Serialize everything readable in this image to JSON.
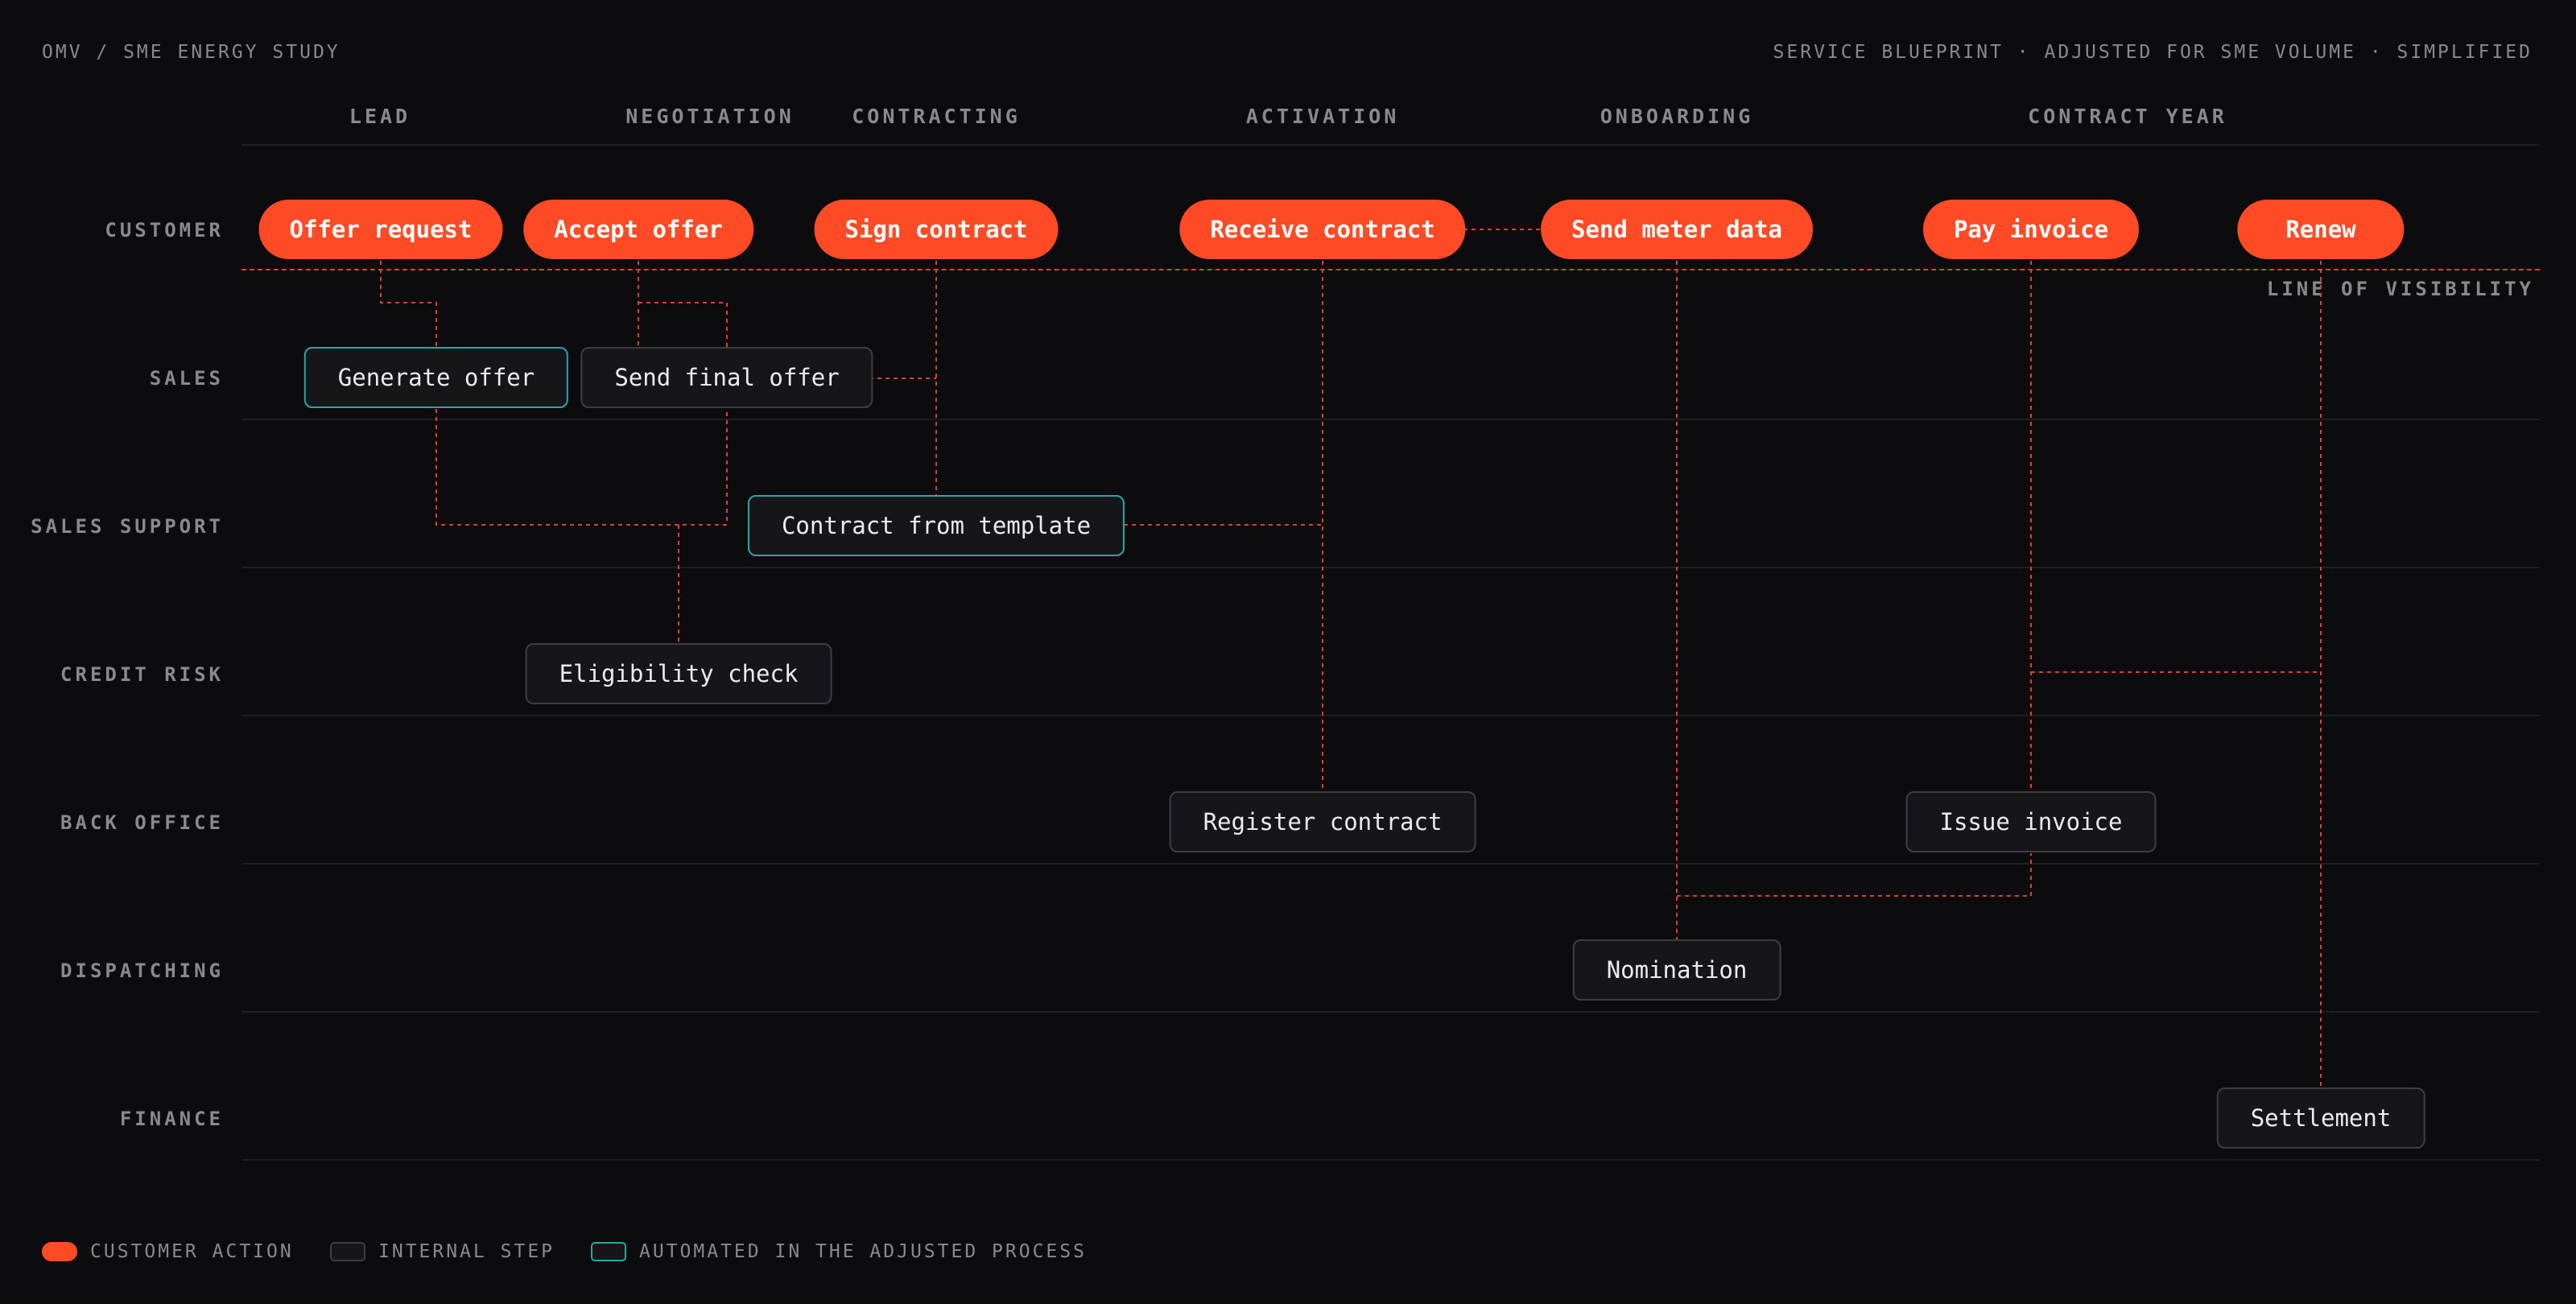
{
  "header": {
    "left": "OMV / SME ENERGY STUDY",
    "right": "SERVICE BLUEPRINT · ADJUSTED FOR SME VOLUME · SIMPLIFIED"
  },
  "phases": [
    "LEAD",
    "NEGOTIATION",
    "CONTRACTING",
    "ACTIVATION",
    "ONBOARDING",
    "CONTRACT YEAR"
  ],
  "lanes": [
    "CUSTOMER",
    "SALES",
    "SALES SUPPORT",
    "CREDIT RISK",
    "BACK OFFICE",
    "DISPATCHING",
    "FINANCE"
  ],
  "line_of_visibility": "LINE OF VISIBILITY",
  "nodes": [
    {
      "label": "Offer request",
      "type": "customer",
      "lane": "CUSTOMER"
    },
    {
      "label": "Accept offer",
      "type": "customer",
      "lane": "CUSTOMER"
    },
    {
      "label": "Sign contract",
      "type": "customer",
      "lane": "CUSTOMER"
    },
    {
      "label": "Receive contract",
      "type": "customer",
      "lane": "CUSTOMER"
    },
    {
      "label": "Send meter data",
      "type": "customer",
      "lane": "CUSTOMER"
    },
    {
      "label": "Pay invoice",
      "type": "customer",
      "lane": "CUSTOMER"
    },
    {
      "label": "Renew",
      "type": "customer",
      "lane": "CUSTOMER"
    },
    {
      "label": "Generate offer",
      "type": "automated",
      "lane": "SALES"
    },
    {
      "label": "Send final offer",
      "type": "internal",
      "lane": "SALES"
    },
    {
      "label": "Contract from template",
      "type": "automated",
      "lane": "SALES SUPPORT"
    },
    {
      "label": "Eligibility check",
      "type": "internal",
      "lane": "CREDIT RISK"
    },
    {
      "label": "Register contract",
      "type": "internal",
      "lane": "BACK OFFICE"
    },
    {
      "label": "Issue invoice",
      "type": "internal",
      "lane": "BACK OFFICE"
    },
    {
      "label": "Nomination",
      "type": "internal",
      "lane": "DISPATCHING"
    },
    {
      "label": "Settlement",
      "type": "internal",
      "lane": "FINANCE"
    }
  ],
  "legend": {
    "customer": "CUSTOMER ACTION",
    "internal": "INTERNAL STEP",
    "automated": "AUTOMATED IN THE ADJUSTED PROCESS"
  },
  "colors": {
    "accent": "#ff4a26",
    "automated": "#2aa5a8",
    "internal_border": "#3d3d44",
    "connector": "#e0402a",
    "background": "#0c0c0e"
  }
}
